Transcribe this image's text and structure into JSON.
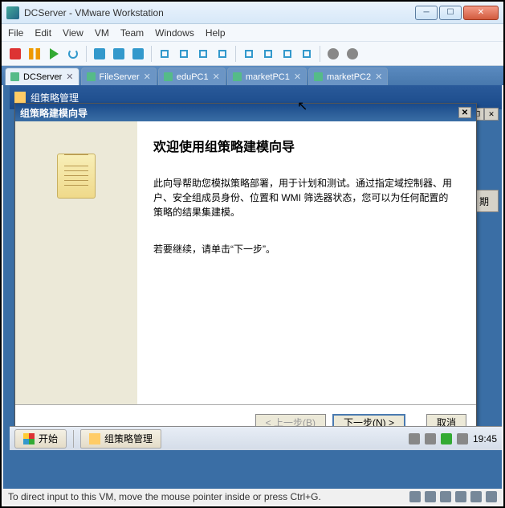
{
  "window": {
    "title": "DCServer - VMware Workstation"
  },
  "menu": {
    "file": "File",
    "edit": "Edit",
    "view": "View",
    "vm": "VM",
    "team": "Team",
    "windows": "Windows",
    "help": "Help"
  },
  "tabs": [
    {
      "label": "DCServer",
      "active": true
    },
    {
      "label": "FileServer",
      "active": false
    },
    {
      "label": "eduPC1",
      "active": false
    },
    {
      "label": "marketPC1",
      "active": false
    },
    {
      "label": "marketPC2",
      "active": false
    }
  ],
  "inner_window": {
    "title": "组策略管理"
  },
  "right_header": {
    "label": "期"
  },
  "wizard": {
    "title": "组策略建模向导",
    "heading": "欢迎使用组策略建模向导",
    "body1": "此向导帮助您模拟策略部署，用于计划和测试。通过指定域控制器、用户、安全组成员身份、位置和 WMI 筛选器状态，您可以为任何配置的策略的结果集建模。",
    "body2": "若要继续，请单击“下一步”。",
    "back": "< 上一步(B)",
    "next": "下一步(N) >",
    "cancel": "取消"
  },
  "taskbar": {
    "start": "开始",
    "app": "组策略管理",
    "time": "19:45"
  },
  "status": {
    "hint": "To direct input to this VM, move the mouse pointer inside or press Ctrl+G."
  }
}
